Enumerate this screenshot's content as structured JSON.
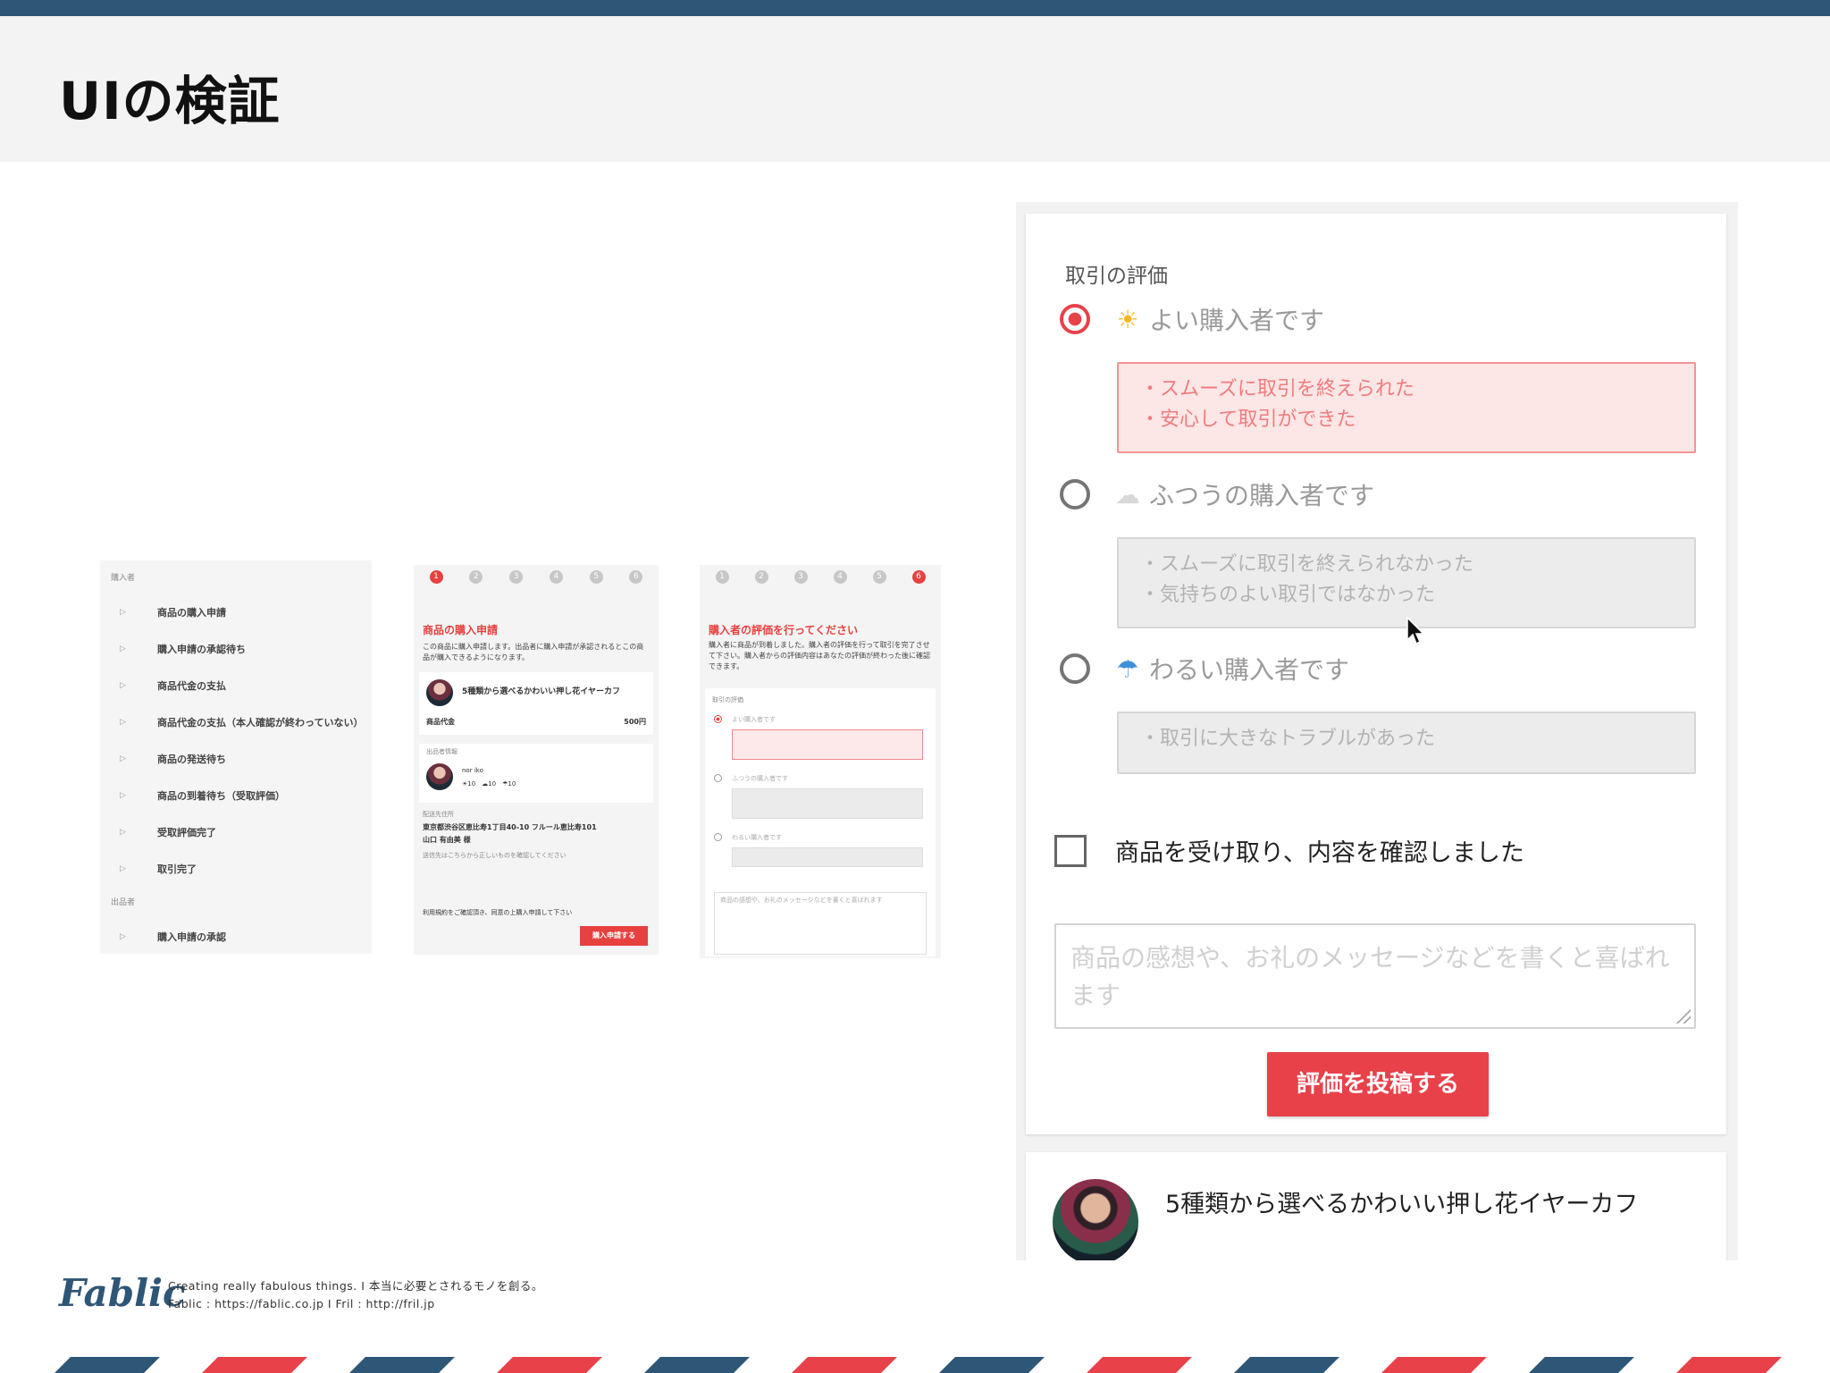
{
  "page": {
    "title": "UIの検証"
  },
  "colors": {
    "navy": "#2e5677",
    "accent_red": "#e8414a",
    "pink_bg": "#fde6e6"
  },
  "thumb_nav": {
    "section1": "購入者",
    "items": [
      "商品の購入申請",
      "購入申請の承認待ち",
      "商品代金の支払",
      "商品代金の支払（本人確認が終わっていない）",
      "商品の発送待ち",
      "商品の到着待ち（受取評価）",
      "受取評価完了",
      "取引完了"
    ],
    "section2": "出品者",
    "items2": [
      "購入申請の承認"
    ]
  },
  "thumb_purchase": {
    "title": "商品の購入申請",
    "desc": "この商品に購入申請します。出品者に購入申請が承認されるとこの商品が購入できるようになります。",
    "item_name": "5種類から選べるかわいい押し花イヤーカフ",
    "price_label": "商品代金",
    "price": "500円",
    "seller_label": "出品者情報",
    "seller_name": "nor iko",
    "ratings": "☀10　☁10　☂10",
    "shipping_label": "配送先住所",
    "address": "東京都渋谷区恵比寿1丁目40-10 フルール恵比寿101",
    "recipient": "山口 有由美 様",
    "address_note": "送信先はこちらから正しいものを確認してください",
    "terms": "利用規約をご確認頂き、同意の上購入申請して下さい",
    "button": "購入申請する"
  },
  "thumb_review": {
    "title": "購入者の評価を行ってください",
    "desc": "購入者に商品が到着しました。購入者の評価を行って取引を完了させて下さい。購入者からの評価内容はあなたの評価が終わった後に確認できます。",
    "section": "取引の評価",
    "good": "よい購入者です",
    "normal": "ふつうの購入者です",
    "bad": "わるい購入者です",
    "placeholder": "商品の感想や、お礼のメッセージなどを書くと喜ばれます"
  },
  "review_form": {
    "title": "取引の評価",
    "options": [
      {
        "label": "よい購入者です",
        "icon": "sun-icon",
        "selected": true,
        "lines": [
          "・スムーズに取引を終えられた",
          "・安心して取引ができた"
        ]
      },
      {
        "label": "ふつうの購入者です",
        "icon": "cloud-icon",
        "selected": false,
        "lines": [
          "・スムーズに取引を終えられなかった",
          "・気持ちのよい取引ではなかった"
        ]
      },
      {
        "label": "わるい購入者です",
        "icon": "umbrella-icon",
        "selected": false,
        "lines": [
          "・取引に大きなトラブルがあった"
        ]
      }
    ],
    "checkbox_label": "商品を受け取り、内容を確認しました",
    "comment_placeholder": "商品の感想や、お礼のメッセージなどを書くと喜ばれます",
    "submit_label": "評価を投稿する"
  },
  "item": {
    "name": "5種類から選べるかわいい押し花イヤーカフ"
  },
  "footer": {
    "logo": "Fablic",
    "tagline": "Creating really fabulous things.  I  本当に必要とされるモノを創る。",
    "links": "Fablic : https://fablic.co.jp  I  Fril : http://fril.jp"
  }
}
